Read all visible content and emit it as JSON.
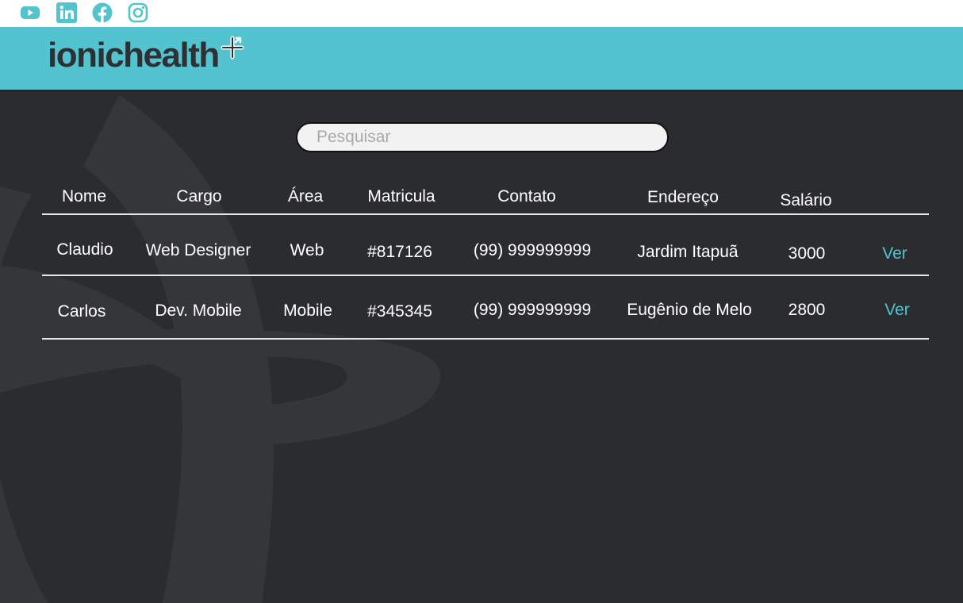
{
  "social": [
    {
      "icon": "youtube-icon"
    },
    {
      "icon": "linkedin-icon"
    },
    {
      "icon": "facebook-icon"
    },
    {
      "icon": "instagram-icon"
    }
  ],
  "brand": {
    "name": "ionichealth",
    "icon": "plus-arrow-icon"
  },
  "colors": {
    "accent": "#52c3cf",
    "background": "#2b2c2f",
    "text": "#ffffff",
    "logo": "#2f3033"
  },
  "search": {
    "placeholder": "Pesquisar",
    "value": ""
  },
  "table": {
    "headers": [
      "Nome",
      "Cargo",
      "Área",
      "Matricula",
      "Contato",
      "Endereço",
      "Salário"
    ],
    "rows": [
      [
        "Claudio",
        "Web Designer",
        "Web",
        "#817126",
        "(99) 999999999",
        "Jardim Itapuã",
        "3000",
        "Ver"
      ],
      [
        "Carlos",
        "Dev. Mobile",
        "Mobile",
        "#345345",
        "(99) 999999999",
        "Eugênio de Melo",
        "2800",
        "Ver"
      ]
    ]
  }
}
